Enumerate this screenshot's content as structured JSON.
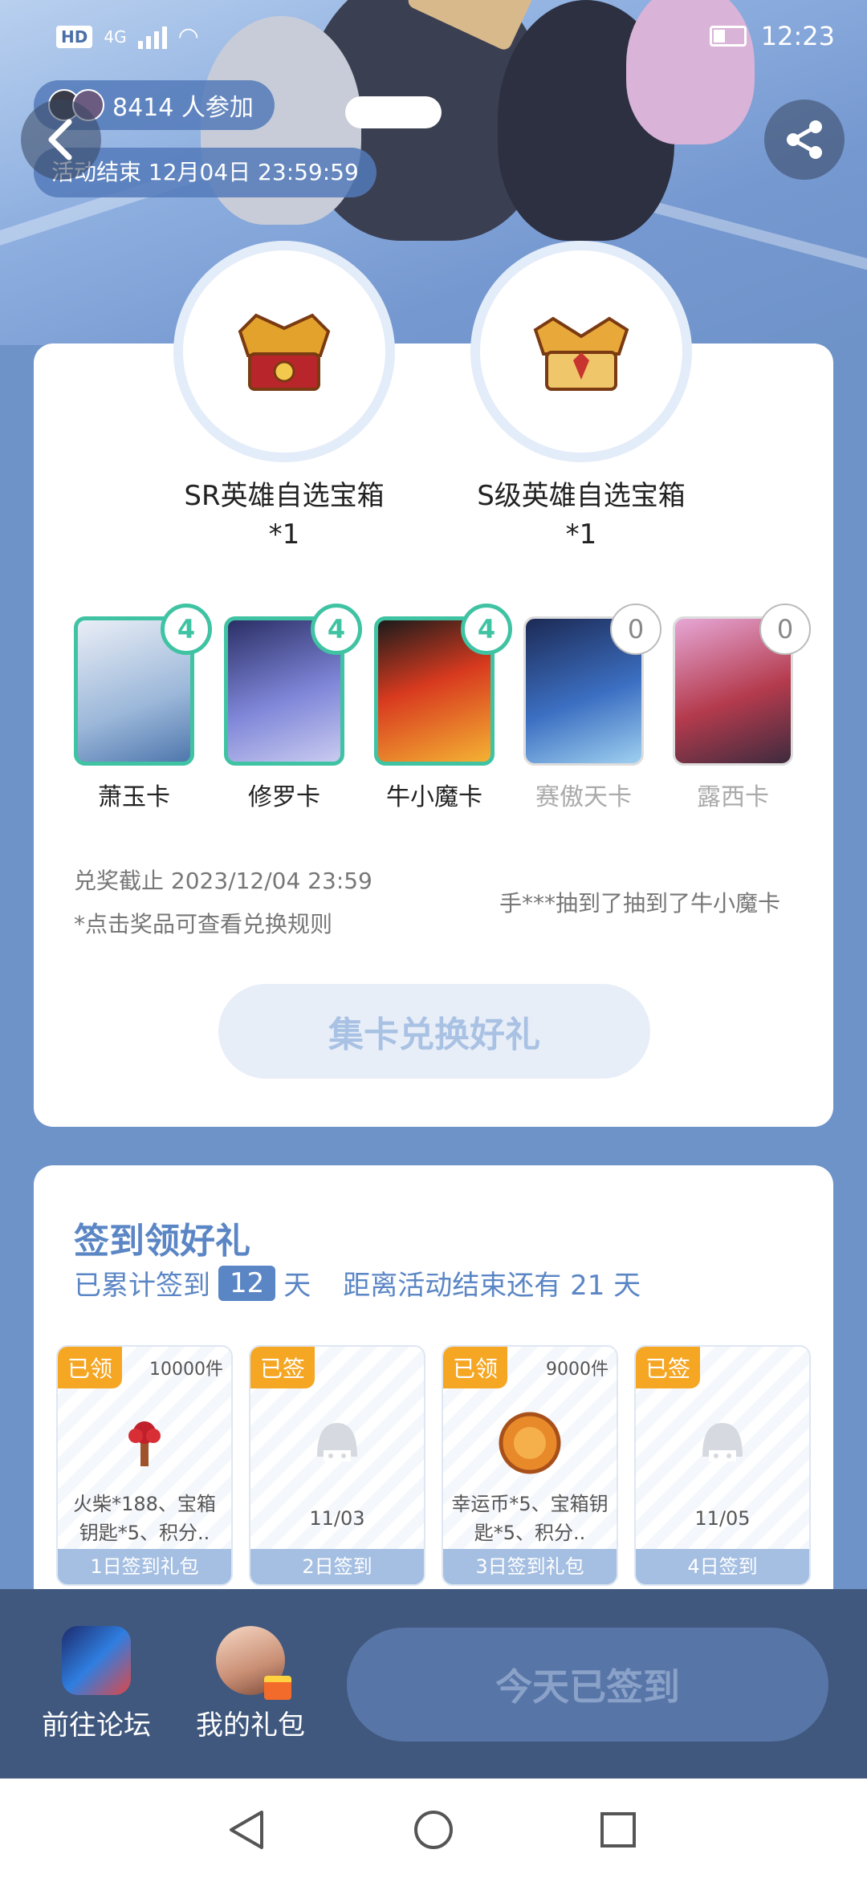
{
  "status_bar": {
    "net": "4G",
    "time": "12:23",
    "hd": "HD"
  },
  "header": {
    "participants_text": "8414 人参加",
    "end_time": "活动结束 12月04日 23:59:59"
  },
  "chests": [
    {
      "name": "SR英雄自选宝箱",
      "qty": "*1"
    },
    {
      "name": "S级英雄自选宝箱",
      "qty": "*1"
    }
  ],
  "hero_cards": [
    {
      "name": "萧玉卡",
      "count": "4",
      "owned": true
    },
    {
      "name": "修罗卡",
      "count": "4",
      "owned": true
    },
    {
      "name": "牛小魔卡",
      "count": "4",
      "owned": true
    },
    {
      "name": "赛傲天卡",
      "count": "0",
      "owned": false
    },
    {
      "name": "露西卡",
      "count": "0",
      "owned": false
    }
  ],
  "exchange": {
    "deadline": "兑奖截止 2023/12/04 23:59",
    "note": "*点击奖品可查看兑换规则",
    "ticker": "手***抽到了抽到了牛小魔卡",
    "button": "集卡兑换好礼"
  },
  "sign_in": {
    "title": "签到领好礼",
    "prefix": "已累计签到",
    "days": "12",
    "unit": "天",
    "remaining": "距离活动结束还有 21 天"
  },
  "rewards": [
    {
      "tag": "已领",
      "count": "10000件",
      "desc": "火柴*188、宝箱钥匙*5、积分..",
      "footer": "1日签到礼包"
    },
    {
      "tag": "已签",
      "date": "11/03",
      "footer": "2日签到"
    },
    {
      "tag": "已领",
      "count": "9000件",
      "desc": "幸运币*5、宝箱钥匙*5、积分..",
      "footer": "3日签到礼包"
    },
    {
      "tag": "已签",
      "date": "11/05",
      "footer": "4日签到"
    }
  ],
  "bottom_bar": {
    "forum": "前往论坛",
    "gifts": "我的礼包",
    "checked_in": "今天已签到"
  }
}
